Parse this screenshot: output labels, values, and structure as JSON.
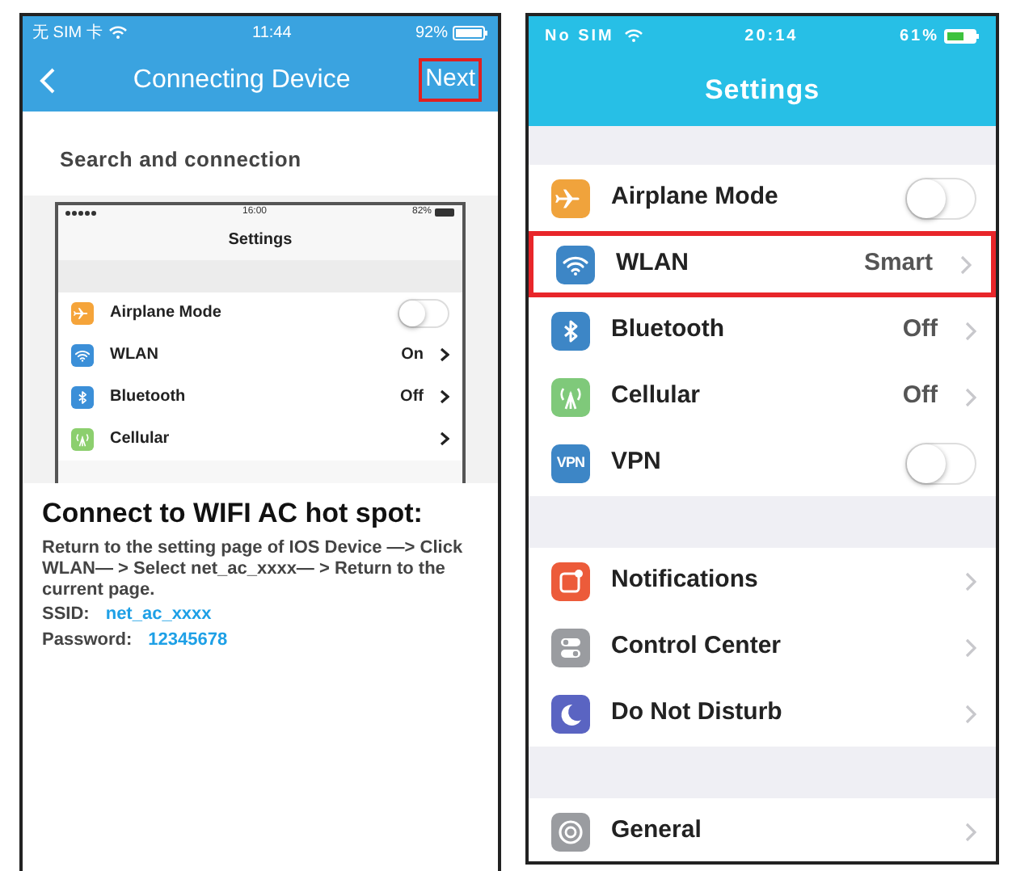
{
  "left_phone": {
    "status_bar": {
      "carrier": "无 SIM 卡",
      "time": "11:44",
      "battery": "92%"
    },
    "nav_bar": {
      "title": "Connecting Device",
      "next": "Next",
      "next_highlighted": true
    },
    "section_title": "Search and connection",
    "embedded_screenshot": {
      "status_bar": {
        "time": "16:00",
        "battery": "82%"
      },
      "title": "Settings",
      "rows": [
        {
          "kind": "toggle",
          "label": "Airplane Mode",
          "on": false,
          "color": "#f5a43a"
        },
        {
          "kind": "value",
          "label": "WLAN",
          "value": "On",
          "color": "#3b8fd8"
        },
        {
          "kind": "value",
          "label": "Bluetooth",
          "value": "Off",
          "color": "#3b8fd8"
        },
        {
          "kind": "link",
          "label": "Cellular",
          "color": "#8ccf6e"
        }
      ]
    },
    "hotspot": {
      "title": "Connect to WIFI AC hot spot:",
      "instructions": "Return to the setting page of IOS Device —> Click WLAN— > Select net_ac_xxxx— > Return to the current page.",
      "fields": [
        {
          "label": "SSID:",
          "value": "net_ac_xxxx"
        },
        {
          "label": "Password:",
          "value": "12345678"
        }
      ]
    }
  },
  "right_phone": {
    "status_bar": {
      "carrier": "No SIM",
      "time": "20:14",
      "battery": "61%"
    },
    "title": "Settings",
    "groups": [
      [
        {
          "kind": "toggle",
          "label": "Airplane Mode",
          "on": false,
          "color": "#f0a33c",
          "highlighted": false
        },
        {
          "kind": "value",
          "label": "WLAN",
          "value": "Smart",
          "color": "#3d86c6",
          "highlighted": true
        },
        {
          "kind": "value",
          "label": "Bluetooth",
          "value": "Off",
          "color": "#3d86c6",
          "highlighted": false
        },
        {
          "kind": "value",
          "label": "Cellular",
          "value": "Off",
          "color": "#7fc97a",
          "highlighted": false
        },
        {
          "kind": "toggle",
          "label": "VPN",
          "on": false,
          "color": "#3d86c6",
          "icon_text": "VPN",
          "highlighted": false
        }
      ],
      [
        {
          "kind": "link",
          "label": "Notifications",
          "color": "#ec5b3a",
          "highlighted": false
        },
        {
          "kind": "link",
          "label": "Control Center",
          "color": "#9a9ca0",
          "highlighted": false
        },
        {
          "kind": "link",
          "label": "Do Not Disturb",
          "color": "#5a64c2",
          "highlighted": false
        }
      ],
      [
        {
          "kind": "link",
          "label": "General",
          "color": "#9a9ca0",
          "highlighted": false
        }
      ]
    ]
  }
}
